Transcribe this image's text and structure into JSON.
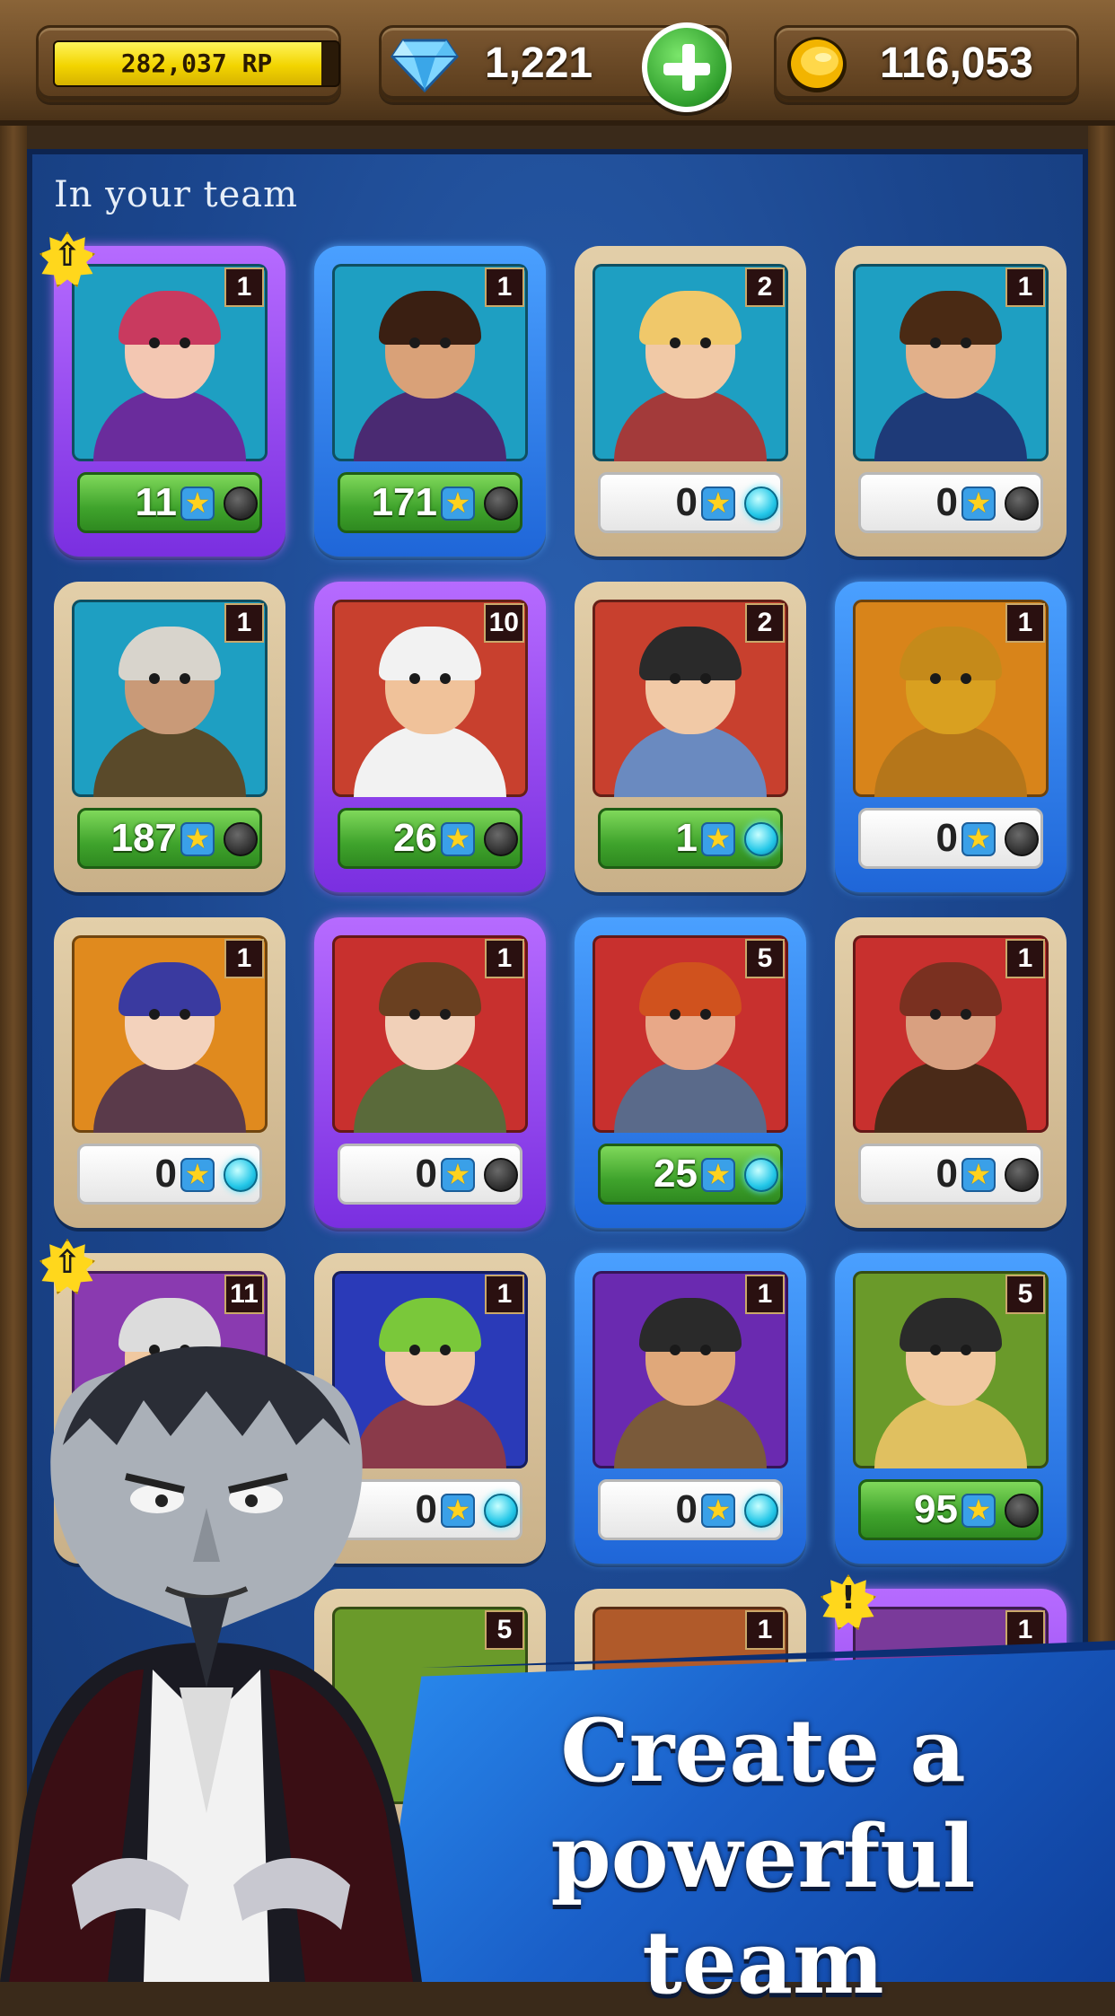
{
  "header": {
    "rp_value": "282,037 RP",
    "rp_progress": 0.94,
    "gems_value": "1,221",
    "gold_value": "116,053",
    "gem_icon": "diamond-icon",
    "gold_icon": "gold-coin-icon",
    "add_icon": "plus-icon"
  },
  "section": {
    "title": "In your team"
  },
  "cards": [
    {
      "rarity": "purple",
      "level": "1",
      "count": "11",
      "count_style": "green",
      "orb": "dark",
      "bg": "#1e9fc2",
      "skin": "#f3c7b2",
      "hair": "#c93a5f",
      "body": "#6a2c9c",
      "upgrade": true
    },
    {
      "rarity": "blue",
      "level": "1",
      "count": "171",
      "count_style": "green",
      "orb": "dark",
      "bg": "#1e9fc2",
      "skin": "#d9a178",
      "hair": "#3a1f12",
      "body": "#4a2a72",
      "upgrade": false
    },
    {
      "rarity": "tan",
      "level": "2",
      "count": "0",
      "count_style": "white",
      "orb": "cyan",
      "bg": "#1e9fc2",
      "skin": "#f1c9a6",
      "hair": "#f0c86a",
      "body": "#a33a3a",
      "upgrade": false
    },
    {
      "rarity": "tan",
      "level": "1",
      "count": "0",
      "count_style": "white",
      "orb": "dark",
      "bg": "#1e9fc2",
      "skin": "#e2b08a",
      "hair": "#4a2a14",
      "body": "#1e3a78",
      "upgrade": false
    },
    {
      "rarity": "tan",
      "level": "1",
      "count": "187",
      "count_style": "green",
      "orb": "dark",
      "bg": "#1e9fc2",
      "skin": "#c99a78",
      "hair": "#d8d4cc",
      "body": "#5a4a2a",
      "upgrade": false
    },
    {
      "rarity": "purple",
      "level": "10",
      "count": "26",
      "count_style": "green",
      "orb": "dark",
      "bg": "#c8402e",
      "skin": "#f0c29a",
      "hair": "#f2f2f2",
      "body": "#f2f2f2",
      "upgrade": false
    },
    {
      "rarity": "tan",
      "level": "2",
      "count": "1",
      "count_style": "green",
      "orb": "cyan",
      "bg": "#c8402e",
      "skin": "#f1c9a6",
      "hair": "#2a2a2a",
      "body": "#6a8ac0",
      "upgrade": false
    },
    {
      "rarity": "blue",
      "level": "1",
      "count": "0",
      "count_style": "white",
      "orb": "dark",
      "bg": "#d8841a",
      "skin": "#d9a020",
      "hair": "#c58a1a",
      "body": "#b5761a",
      "upgrade": false
    },
    {
      "rarity": "tan",
      "level": "1",
      "count": "0",
      "count_style": "white",
      "orb": "cyan",
      "bg": "#e08a1e",
      "skin": "#f3d2bc",
      "hair": "#3a3aa0",
      "body": "#5a3a4a",
      "upgrade": false
    },
    {
      "rarity": "purple",
      "level": "1",
      "count": "0",
      "count_style": "white",
      "orb": "dark",
      "bg": "#c8302e",
      "skin": "#f1d0b8",
      "hair": "#6a4020",
      "body": "#5a6a3a",
      "upgrade": false
    },
    {
      "rarity": "blue",
      "level": "5",
      "count": "25",
      "count_style": "green",
      "orb": "cyan",
      "bg": "#c8302e",
      "skin": "#e8a888",
      "hair": "#d0521e",
      "body": "#5a6a8a",
      "upgrade": false
    },
    {
      "rarity": "tan",
      "level": "1",
      "count": "0",
      "count_style": "white",
      "orb": "dark",
      "bg": "#c8302e",
      "skin": "#d9a080",
      "hair": "#7a3020",
      "body": "#4a2a18",
      "upgrade": false
    },
    {
      "rarity": "tan",
      "level": "11",
      "count": "",
      "count_style": "green",
      "orb": "cyan",
      "bg": "#8a3ab0",
      "skin": "#f0c8a0",
      "hair": "#dcdcdc",
      "body": "#6a4a8a",
      "upgrade": true
    },
    {
      "rarity": "tan",
      "level": "1",
      "count": "0",
      "count_style": "white",
      "orb": "cyan",
      "bg": "#2a3ab8",
      "skin": "#f0c8a8",
      "hair": "#7ac83a",
      "body": "#8a3a4a",
      "upgrade": false
    },
    {
      "rarity": "blue",
      "level": "1",
      "count": "0",
      "count_style": "white",
      "orb": "cyan",
      "bg": "#6a2ab0",
      "skin": "#e0a87a",
      "hair": "#2a2a2a",
      "body": "#7a5a3a",
      "upgrade": false
    },
    {
      "rarity": "blue",
      "level": "5",
      "count": "95",
      "count_style": "green",
      "orb": "dark",
      "bg": "#6a9a2a",
      "skin": "#f0c8a0",
      "hair": "#2a2a2a",
      "body": "#e0c060",
      "upgrade": false
    }
  ],
  "partial_cards": [
    {
      "rarity": "tan",
      "level": "5",
      "bg": "#6a9a2a"
    },
    {
      "rarity": "tan",
      "level": "1",
      "bg": "#b05a2a"
    },
    {
      "rarity": "purple",
      "level": "1",
      "bg": "#7a3a9a",
      "alert": "!"
    }
  ],
  "promo": {
    "text": "Create a powerful team"
  }
}
